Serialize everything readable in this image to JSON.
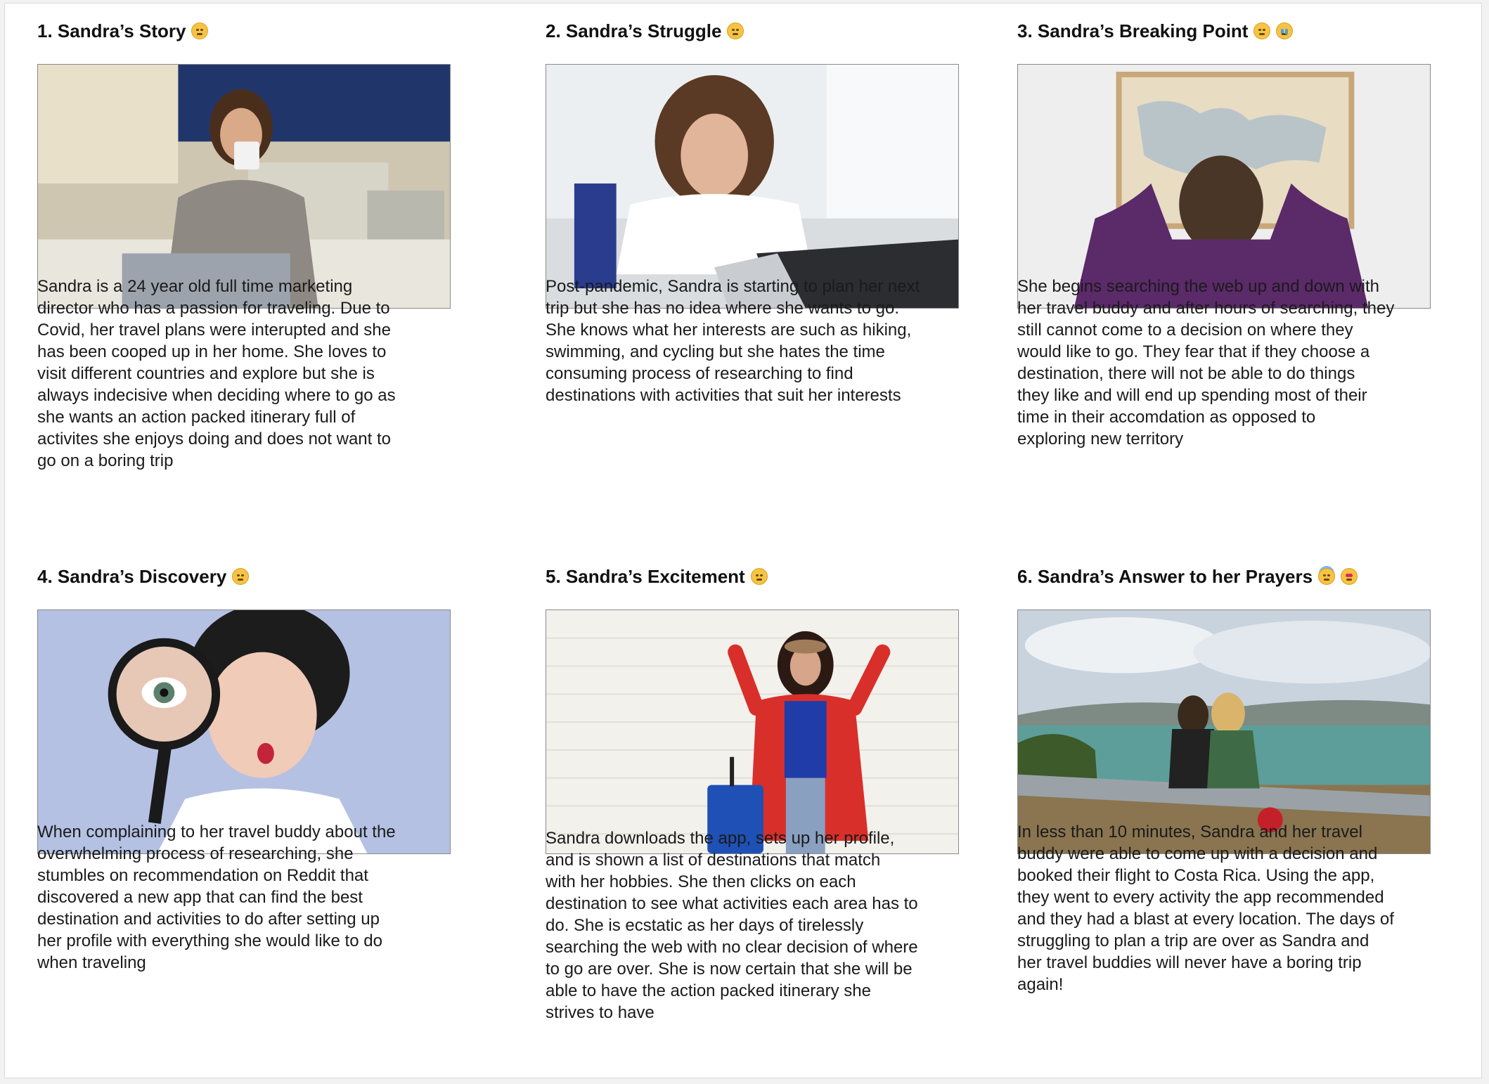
{
  "panels": [
    {
      "title": "1. Sandra’s Story",
      "text": "Sandra is a 24 year old full time marketing\ndirector who has a passion for traveling. Due to\nCovid, her travel plans were interupted and she\nhas been cooped up in her home. She loves to\nvisit different countries and explore but she is\nalways indecisive when deciding where to go as\nshe wants an action packed itinerary full of\nactivites she enjoys doing and does not want to\ngo on a boring trip",
      "emoji": [
        "unamused-face-icon"
      ]
    },
    {
      "title": "2. Sandra’s Struggle",
      "text": "Post-pandemic, Sandra is starting to plan her next\ntrip but she has no idea where she wants to go.\nShe knows what her interests are such as hiking,\nswimming, and cycling but she hates the time\nconsuming process of researching to find\ndestinations with activities that suit her interests",
      "emoji": [
        "persevering-face-icon"
      ]
    },
    {
      "title": "3. Sandra’s Breaking Point",
      "text": "She begins searching the web up and down with\nher travel buddy and after hours of searching, they\nstill cannot come to a decision on where they\nwould like to go. They fear that if they choose a\ndestination, there will not be able to do things\nthey like and will end up spending most of their\ntime in their accomdation as opposed to\nexploring new territory",
      "emoji": [
        "frustrated-face-icon",
        "crying-face-icon"
      ]
    },
    {
      "title": "4. Sandra’s Discovery",
      "text": "When complaining to her travel buddy about the\noverwhelming process of researching, she\nstumbles on recommendation on Reddit that\ndiscovered a new app that can find the best\ndestination and activities to do after setting up\nher profile with everything she would like to do\nwhen traveling",
      "emoji": [
        "thinking-face-icon"
      ]
    },
    {
      "title": "5. Sandra’s Excitement",
      "text": "Sandra downloads the app, sets up her profile,\nand is shown a list of destinations that match\nwith her hobbies. She then clicks on each\ndestination to see what activities each area has to\ndo. She is ecstatic as her days of tirelessly\nsearching the web with no clear decision of where\nto go are over. She is now certain that she will be\nable to have the action packed itinerary she\nstrives to have",
      "emoji": [
        "hugging-face-icon"
      ]
    },
    {
      "title": "6. Sandra’s Answer to her Prayers",
      "text": "In less than 10 minutes, Sandra and her travel\nbuddy were able to come up with a decision and\nbooked their flight to Costa Rica. Using the app,\nthey went to every activity the app recommended\nand they had a blast at every location. The days of\nstruggling to plan a trip are over as Sandra and\nher travel buddies will never have a boring trip\nagain!",
      "emoji": [
        "halo-face-icon",
        "heart-eyes-face-icon"
      ]
    }
  ]
}
